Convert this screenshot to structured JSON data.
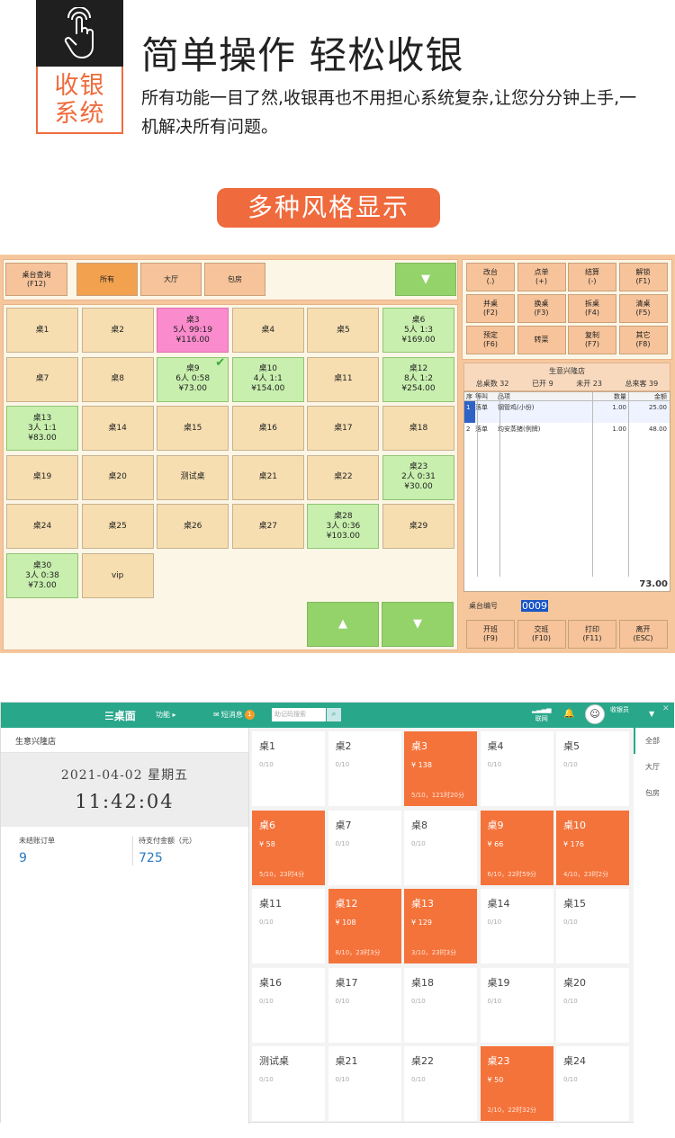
{
  "header": {
    "logo_text": "收银系统",
    "headline": "简单操作 轻松收银",
    "description": "所有功能一目了然,收银再也不用担心系统复杂,让您分分钟上手,一机解决所有问题。",
    "pill": "多种风格显示"
  },
  "screen1": {
    "query_btn": [
      "桌台查询",
      "(F12)"
    ],
    "tabs": [
      "所有",
      "大厅",
      "包房"
    ],
    "down_arrow": "▼",
    "up_arrow": "▲",
    "tiles": [
      {
        "lines": [
          "桌1"
        ],
        "state": "free"
      },
      {
        "lines": [
          "桌2"
        ],
        "state": "free"
      },
      {
        "lines": [
          "桌3",
          "5人 99:19",
          "¥116.00"
        ],
        "state": "pink"
      },
      {
        "lines": [
          "桌4"
        ],
        "state": "free"
      },
      {
        "lines": [
          "桌5"
        ],
        "state": "free"
      },
      {
        "lines": [
          "桌6",
          "5人 1:3",
          "¥169.00"
        ],
        "state": "occ"
      },
      {
        "lines": [
          "桌7"
        ],
        "state": "free"
      },
      {
        "lines": [
          "桌8"
        ],
        "state": "free"
      },
      {
        "lines": [
          "桌9",
          "6人 0:58",
          "¥73.00"
        ],
        "state": "occ",
        "check": true
      },
      {
        "lines": [
          "桌10",
          "4人 1:1",
          "¥154.00"
        ],
        "state": "occ"
      },
      {
        "lines": [
          "桌11"
        ],
        "state": "free"
      },
      {
        "lines": [
          "桌12",
          "8人 1:2",
          "¥254.00"
        ],
        "state": "occ"
      },
      {
        "lines": [
          "桌13",
          "3人 1:1",
          "¥83.00"
        ],
        "state": "occ"
      },
      {
        "lines": [
          "桌14"
        ],
        "state": "free"
      },
      {
        "lines": [
          "桌15"
        ],
        "state": "free"
      },
      {
        "lines": [
          "桌16"
        ],
        "state": "free"
      },
      {
        "lines": [
          "桌17"
        ],
        "state": "free"
      },
      {
        "lines": [
          "桌18"
        ],
        "state": "free"
      },
      {
        "lines": [
          "桌19"
        ],
        "state": "free"
      },
      {
        "lines": [
          "桌20"
        ],
        "state": "free"
      },
      {
        "lines": [
          "测试桌"
        ],
        "state": "free"
      },
      {
        "lines": [
          "桌21"
        ],
        "state": "free"
      },
      {
        "lines": [
          "桌22"
        ],
        "state": "free"
      },
      {
        "lines": [
          "桌23",
          "2人 0:31",
          "¥30.00"
        ],
        "state": "occ"
      },
      {
        "lines": [
          "桌24"
        ],
        "state": "free"
      },
      {
        "lines": [
          "桌25"
        ],
        "state": "free"
      },
      {
        "lines": [
          "桌26"
        ],
        "state": "free"
      },
      {
        "lines": [
          "桌27"
        ],
        "state": "free"
      },
      {
        "lines": [
          "桌28",
          "3人 0:36",
          "¥103.00"
        ],
        "state": "occ"
      },
      {
        "lines": [
          "桌29"
        ],
        "state": "free"
      },
      {
        "lines": [
          "桌30",
          "3人 0:38",
          "¥73.00"
        ],
        "state": "occ"
      },
      {
        "lines": [
          "vip"
        ],
        "state": "free"
      }
    ],
    "func_buttons": [
      [
        "改台",
        "(.)"
      ],
      [
        "点单",
        "(+)"
      ],
      [
        "结算",
        "(-)"
      ],
      [
        "解锁",
        "(F1)"
      ],
      [
        "并桌",
        "(F2)"
      ],
      [
        "换桌",
        "(F3)"
      ],
      [
        "拆桌",
        "(F4)"
      ],
      [
        "清桌",
        "(F5)"
      ],
      [
        "预定",
        "(F6)"
      ],
      [
        "转菜"
      ],
      [
        "复制",
        "(F7)"
      ],
      [
        "其它",
        "(F8)"
      ]
    ],
    "store_name": "生意兴隆店",
    "stats": [
      "总桌数 32",
      "已开 9",
      "未开 23",
      "总来客 39"
    ],
    "order_headers": [
      "序",
      "等叫",
      "品项",
      "数量",
      "金额"
    ],
    "order_rows": [
      [
        "1",
        "落单",
        "钢管鸡(小份)",
        "1.00",
        "25.00"
      ],
      [
        "2",
        "落单",
        "均安蒸猪(例牌)",
        "1.00",
        "48.00"
      ]
    ],
    "order_total": "73.00",
    "table_no_label": "桌台编号",
    "table_no_value": "0009",
    "bottom_buttons": [
      [
        "开班",
        "(F9)"
      ],
      [
        "交班",
        "(F10)"
      ],
      [
        "打印",
        "(F11)"
      ],
      [
        "离开",
        "(ESC)"
      ]
    ]
  },
  "screen2": {
    "menu": "☰桌面",
    "func": "功能 ▸",
    "sms": "短消息",
    "sms_count": "1",
    "search_placeholder": "助记码搜索",
    "net": "联网",
    "user": "收银员",
    "shop": "生意兴隆店",
    "date": "2021-04-02 星期五",
    "time": "11:42:04",
    "kpi1_label": "未结账订单",
    "kpi1_value": "9",
    "kpi2_label": "待支付金额（元）",
    "kpi2_value": "725",
    "tiles": [
      {
        "name": "桌1",
        "sub": "0/10"
      },
      {
        "name": "桌2",
        "sub": "0/10"
      },
      {
        "name": "桌3",
        "sub": "¥ 138",
        "foot": "5/10，121时20分",
        "on": true
      },
      {
        "name": "桌4",
        "sub": "0/10"
      },
      {
        "name": "桌5",
        "sub": "0/10"
      },
      {
        "name": "桌6",
        "sub": "¥ 58",
        "foot": "5/10，23时4分",
        "on": true
      },
      {
        "name": "桌7",
        "sub": "0/10"
      },
      {
        "name": "桌8",
        "sub": "0/10"
      },
      {
        "name": "桌9",
        "sub": "¥ 66",
        "foot": "6/10，22时59分",
        "on": true
      },
      {
        "name": "桌10",
        "sub": "¥ 176",
        "foot": "4/10，23时2分",
        "on": true
      },
      {
        "name": "桌11",
        "sub": "0/10"
      },
      {
        "name": "桌12",
        "sub": "¥ 108",
        "foot": "8/10，23时3分",
        "on": true
      },
      {
        "name": "桌13",
        "sub": "¥ 129",
        "foot": "3/10，23时3分",
        "on": true
      },
      {
        "name": "桌14",
        "sub": "0/10"
      },
      {
        "name": "桌15",
        "sub": "0/10"
      },
      {
        "name": "桌16",
        "sub": "0/10"
      },
      {
        "name": "桌17",
        "sub": "0/10"
      },
      {
        "name": "桌18",
        "sub": "0/10"
      },
      {
        "name": "桌19",
        "sub": "0/10"
      },
      {
        "name": "桌20",
        "sub": "0/10"
      },
      {
        "name": "测试桌",
        "sub": "0/10"
      },
      {
        "name": "桌21",
        "sub": "0/10"
      },
      {
        "name": "桌22",
        "sub": "0/10"
      },
      {
        "name": "桌23",
        "sub": "¥ 50",
        "foot": "2/10，22时32分",
        "on": true
      },
      {
        "name": "桌24",
        "sub": "0/10"
      }
    ],
    "areas": [
      "全部",
      "大厅",
      "包房"
    ]
  }
}
